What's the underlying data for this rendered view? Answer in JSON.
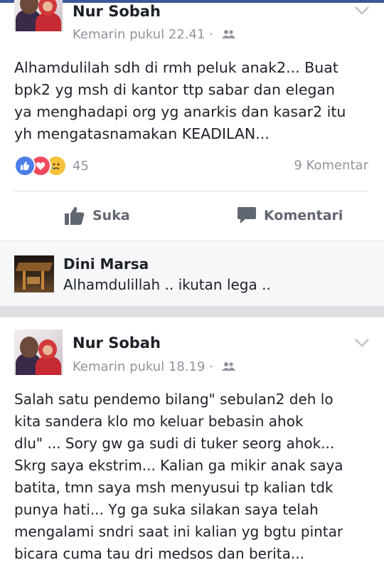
{
  "posts": [
    {
      "author": "Nur Sobah",
      "time": "Kemarin pukul 22.41",
      "separator": "·",
      "audience_icon": "friends-icon",
      "lines": [
        "Alhamdulilah sdh di rmh peluk anak2... Buat",
        "bpk2 yg msh di kantor ttp sabar dan elegan",
        "ya menghadapi org yg anarkis dan kasar2 itu",
        "yh mengatasnamakan KEADILAN..."
      ],
      "reactions": {
        "icons": [
          "like-reaction-icon",
          "love-reaction-icon",
          "sad-reaction-icon"
        ],
        "count": "45",
        "comments": "9 Komentar"
      },
      "actions": {
        "like": "Suka",
        "comment": "Komentari"
      },
      "top_comment": {
        "author": "Dini Marsa",
        "text": "Alhamdulillah .. ikutan lega .."
      }
    },
    {
      "author": "Nur Sobah",
      "time": "Kemarin pukul 18.19",
      "separator": "·",
      "audience_icon": "friends-icon",
      "lines": [
        "Salah satu pendemo bilang\" sebulan2 deh lo",
        "kita sandera klo mo keluar bebasin ahok",
        "dlu\" ... Sory gw ga sudi di tuker seorg ahok...",
        "Skrg saya ekstrim... Kalian ga mikir anak saya",
        "batita, tmn saya msh menyusui tp kalian tdk",
        "punya hati... Yg ga suka silakan saya telah",
        "mengalami sndri saat ini kalian yg bgtu pintar",
        "bicara cuma tau dri medsos dan berita..."
      ]
    }
  ],
  "colors": {
    "brand": "#3b5998",
    "text": "#1d2129",
    "meta": "#90949c",
    "like": "#4e7fe8",
    "love": "#ef4a5e",
    "sad": "#f5c33b"
  }
}
